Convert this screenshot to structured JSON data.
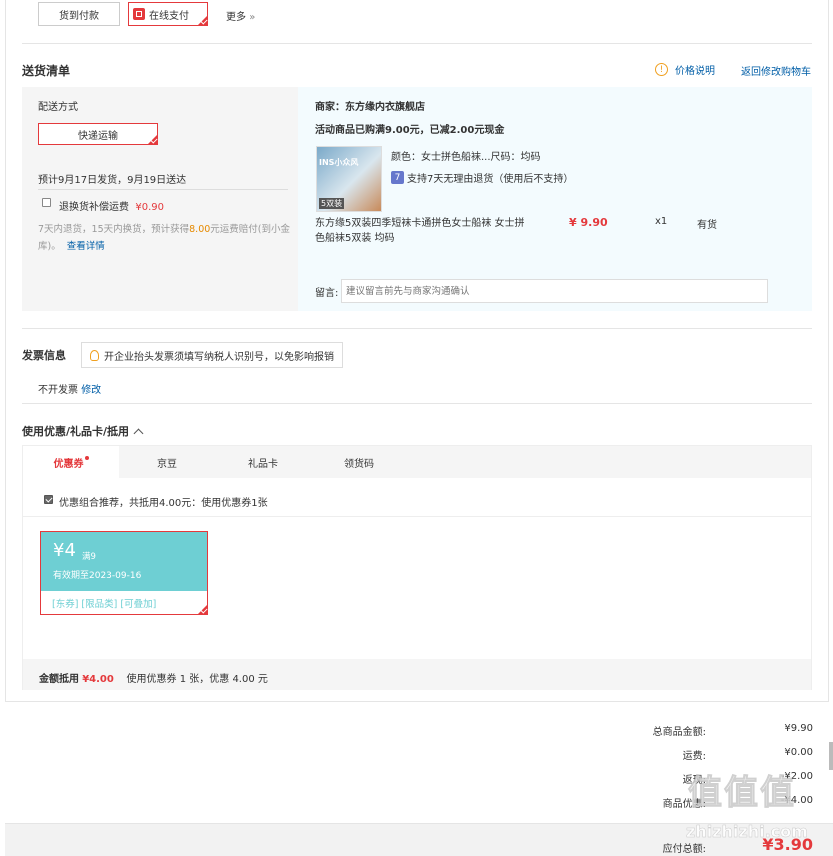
{
  "payment": {
    "cod_label": "货到付款",
    "online_label": "在线支付",
    "more_label": "更多",
    "more_arrow": "»"
  },
  "delivery_list": {
    "title": "送货清单",
    "price_info_label": "价格说明",
    "return_cart_label": "返回修改购物车"
  },
  "shipping": {
    "method_title": "配送方式",
    "express_label": "快递运输",
    "schedule": "预计9月17日发货，9月19日送达",
    "insurance_label": "退换货补偿运费",
    "insurance_price": "¥0.90",
    "insurance_desc_1": "7天内退货，15天内换货，预计获得",
    "insurance_amount": "8.00",
    "insurance_desc_2": "元运费赔付(到小金库)。",
    "details_link": "查看详情"
  },
  "merchant": {
    "label": "商家：东方缘内衣旗舰店",
    "promotion": "活动商品已购满9.00元，已减2.00元现金",
    "product": {
      "thumb_text": "INS小众风",
      "thumb_badge": "5双装",
      "attrs": "颜色：女士拼色船袜...尺码：均码",
      "return_badge": "7",
      "return_policy": "支持7天无理由退货（使用后不支持）",
      "name": "东方缘5双装四季短袜卡通拼色女士船袜 女士拼色船袜5双装 均码",
      "price": "¥ 9.90",
      "qty": "x1",
      "stock": "有货"
    },
    "note_label": "留言:",
    "note_placeholder": "建议留言前先与商家沟通确认"
  },
  "invoice": {
    "title": "发票信息",
    "tip": "开企业抬头发票须填写纳税人识别号，以免影响报销",
    "status": "不开发票",
    "modify_label": "修改"
  },
  "discounts": {
    "title": "使用优惠/礼品卡/抵用",
    "tabs": [
      "优惠券",
      "京豆",
      "礼品卡",
      "领货码"
    ],
    "recommend": "优惠组合推荐，共抵用4.00元：使用优惠券1张",
    "coupon": {
      "amount": "¥4",
      "threshold": "满9",
      "expiry": "有效期至2023-09-16",
      "tags": "[东券] [限品类] [可叠加]"
    },
    "summary_label": "金额抵用",
    "summary_amount": "¥4.00",
    "summary_desc": "使用优惠券 1 张，优惠 4.00 元"
  },
  "totals": {
    "rows": [
      {
        "label": "总商品金额:",
        "value": "¥9.90"
      },
      {
        "label": "运费:",
        "value": "¥0.00"
      },
      {
        "label": "返现:",
        "value": "-¥2.00"
      },
      {
        "label": "商品优惠:",
        "value": "-¥4.00"
      }
    ],
    "payable_label": "应付总额:",
    "payable_value": "¥3.90"
  },
  "watermark": {
    "site": "zhizhizhi.com",
    "logo": "值值值"
  },
  "colors": {
    "accent": "#e4393c",
    "teal": "#6ecfd3",
    "link": "#005ea7",
    "panel": "#f5f5f5",
    "panel_blue": "#f3fbfe"
  }
}
